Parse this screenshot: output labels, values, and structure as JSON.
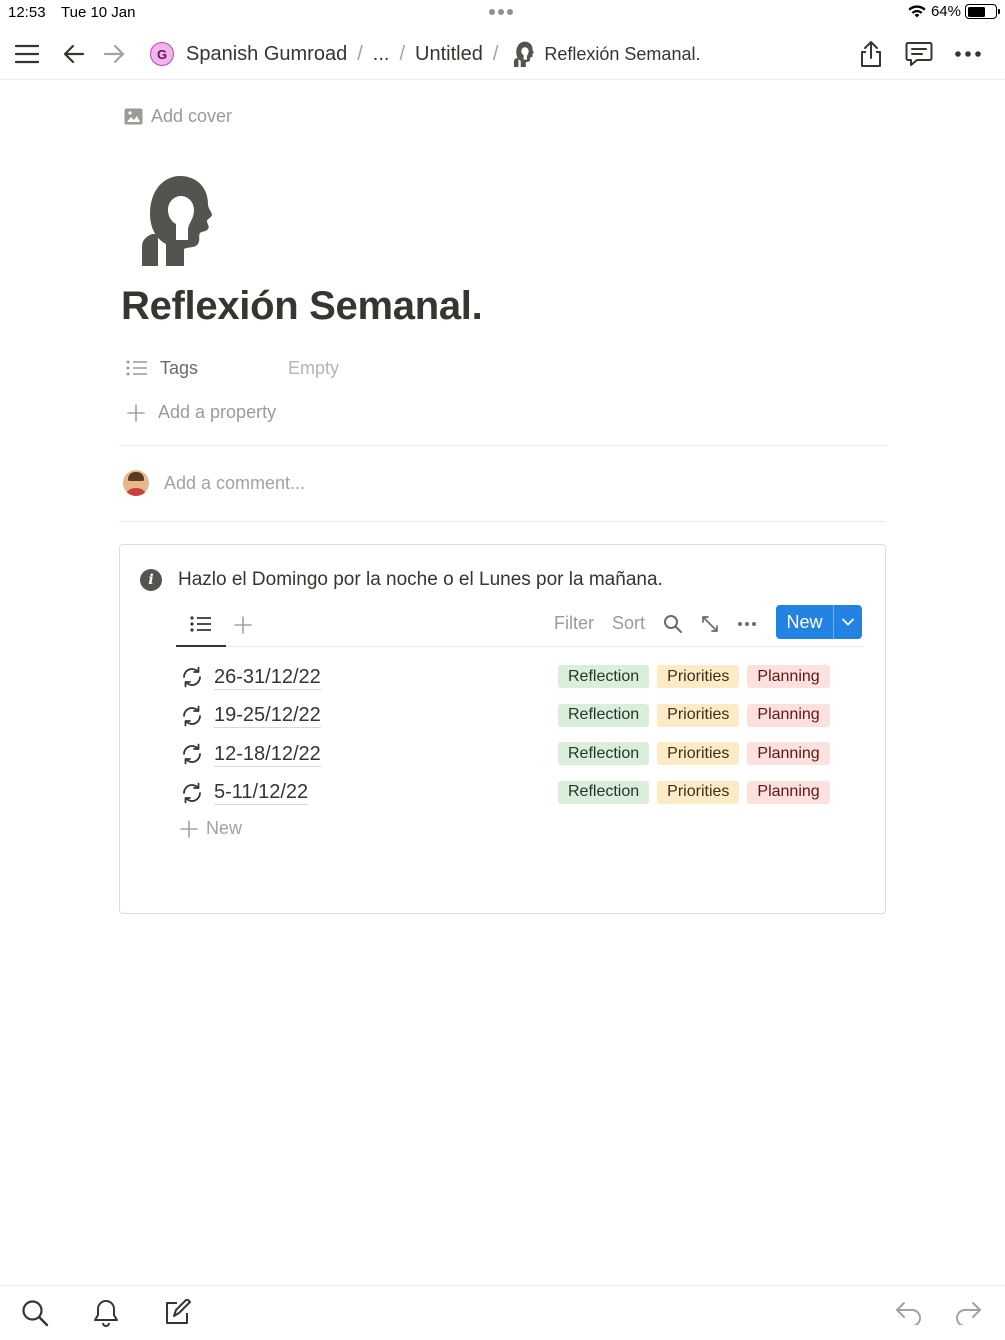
{
  "status_bar": {
    "time": "12:53",
    "date": "Tue 10 Jan",
    "battery": "64%",
    "battery_level": 0.64
  },
  "breadcrumb": {
    "workspace_initial": "G",
    "workspace": "Spanish Gumroad",
    "ellipsis": "...",
    "parent": "Untitled",
    "separator": "/",
    "current": "Reflexión Semanal."
  },
  "page": {
    "add_cover": "Add cover",
    "icon": "head-silhouette-icon",
    "title": "Reflexión Semanal.",
    "property": {
      "name": "Tags",
      "value": "Empty"
    },
    "add_property": "Add a property",
    "comment_placeholder": "Add a comment..."
  },
  "callout": {
    "icon": "info-icon",
    "text": "Hazlo el Domingo por la noche o el Lunes por la mañana."
  },
  "database": {
    "toolbar": {
      "filter": "Filter",
      "sort": "Sort",
      "new_button": "New"
    },
    "rows": [
      {
        "title": "26-31/12/22",
        "tags": [
          "Reflection",
          "Priorities",
          "Planning"
        ]
      },
      {
        "title": "19-25/12/22",
        "tags": [
          "Reflection",
          "Priorities",
          "Planning"
        ]
      },
      {
        "title": "12-18/12/22",
        "tags": [
          "Reflection",
          "Priorities",
          "Planning"
        ]
      },
      {
        "title": "5-11/12/22",
        "tags": [
          "Reflection",
          "Priorities",
          "Planning"
        ]
      }
    ],
    "add_row": "New",
    "tag_colors": {
      "Reflection": "#dbeddb",
      "Priorities": "#fbecc6",
      "Planning": "#fde1df"
    },
    "accent": "#2383e2"
  }
}
